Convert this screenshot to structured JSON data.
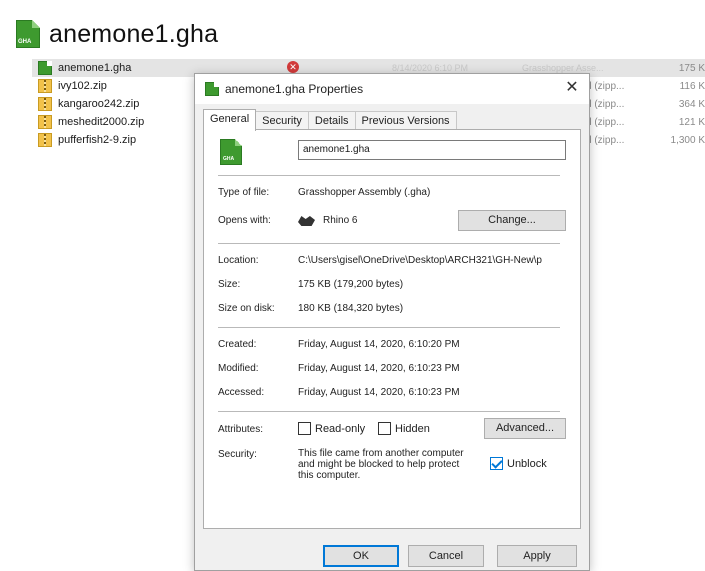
{
  "header": {
    "title": "anemone1.gha",
    "icon": "grasshopper-file-icon"
  },
  "files": [
    {
      "name": "anemone1.gha",
      "type": "Grasshopper Asse...",
      "size": "175 K",
      "icon": "gha-file-icon",
      "selected": true,
      "date_faded": "8/14/2020 6:10 PM",
      "type_faded": "Grasshopper Asse..."
    },
    {
      "name": "ivy102.zip",
      "type": "d (zipp...",
      "size": "116 K",
      "icon": "zip-folder-icon"
    },
    {
      "name": "kangaroo242.zip",
      "type": "d (zipp...",
      "size": "364 K",
      "icon": "zip-folder-icon"
    },
    {
      "name": "meshedit2000.zip",
      "type": "d (zipp...",
      "size": "121 K",
      "icon": "zip-folder-icon"
    },
    {
      "name": "pufferfish2-9.zip",
      "type": "d (zipp...",
      "size": "1,300 K",
      "icon": "zip-folder-icon"
    }
  ],
  "dialog": {
    "title": "anemone1.gha Properties",
    "close": "✕",
    "tabs": [
      "General",
      "Security",
      "Details",
      "Previous Versions"
    ],
    "active_tab": "General",
    "filename": "anemone1.gha",
    "type_label": "Type of file:",
    "type_value": "Grasshopper Assembly (.gha)",
    "opens_label": "Opens with:",
    "opens_value": "Rhino 6",
    "change_button": "Change...",
    "location_label": "Location:",
    "location_value": "C:\\Users\\gisel\\OneDrive\\Desktop\\ARCH321\\GH-New\\p",
    "size_label": "Size:",
    "size_value": "175 KB (179,200 bytes)",
    "disk_label": "Size on disk:",
    "disk_value": "180 KB (184,320 bytes)",
    "created_label": "Created:",
    "created_value": "Friday, August 14, 2020, 6:10:20 PM",
    "modified_label": "Modified:",
    "modified_value": "Friday, August 14, 2020, 6:10:23 PM",
    "accessed_label": "Accessed:",
    "accessed_value": "Friday, August 14, 2020, 6:10:23 PM",
    "attributes_label": "Attributes:",
    "readonly_label": "Read-only",
    "readonly_checked": false,
    "hidden_label": "Hidden",
    "hidden_checked": false,
    "advanced_button": "Advanced...",
    "security_label": "Security:",
    "security_line1": "This file came from another computer",
    "security_line2": "and might be blocked to help protect",
    "security_line3": "this computer.",
    "unblock_label": "Unblock",
    "unblock_checked": true,
    "ok_button": "OK",
    "cancel_button": "Cancel",
    "apply_button": "Apply"
  },
  "colors": {
    "accent": "#0078d7",
    "selection": "#e4e4e4",
    "gha_green": "#3e9a2f",
    "zip_yellow": "#f2c24a"
  }
}
